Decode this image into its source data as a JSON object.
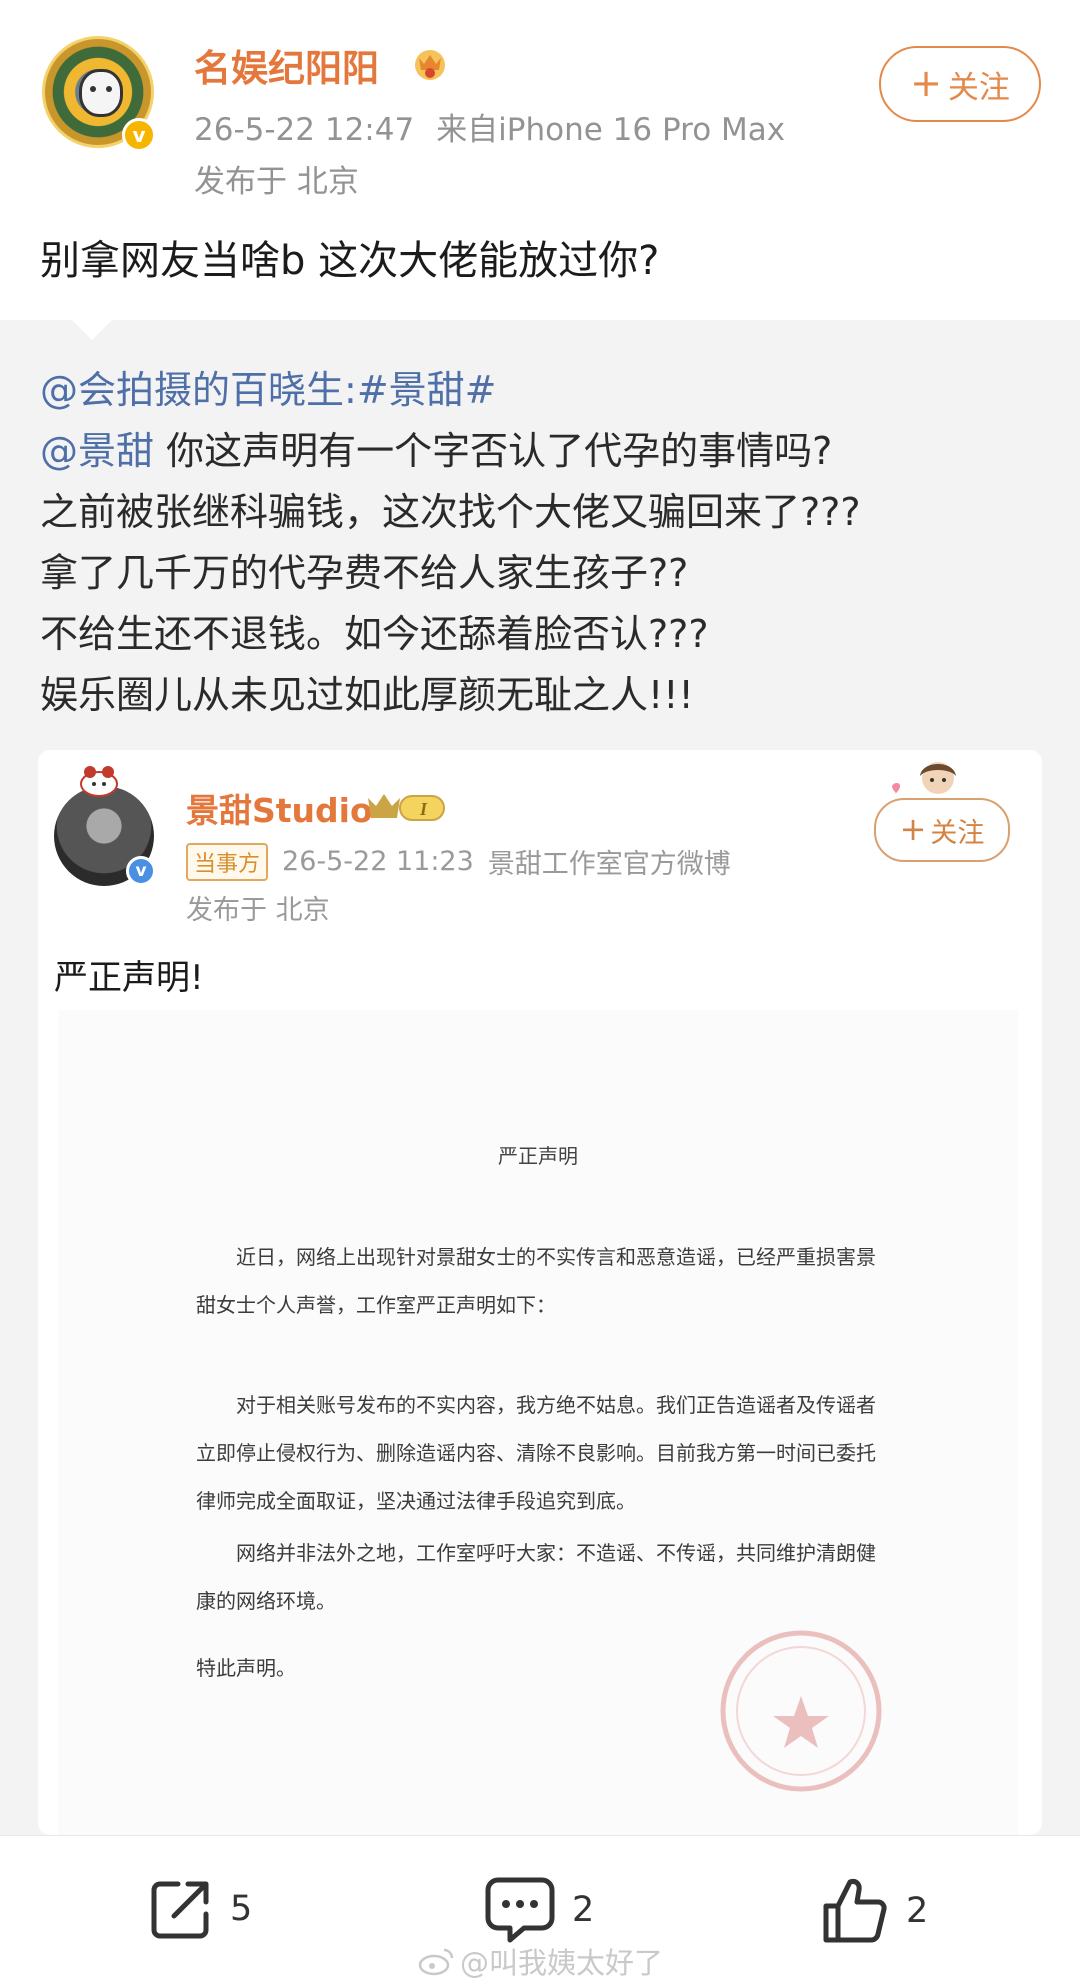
{
  "post": {
    "username": "名娱纪阳阳",
    "timestamp": "26-5-22 12:47",
    "source": "来自iPhone 16 Pro Max",
    "location": "发布于 北京",
    "follow_label": "关注",
    "follow_plus": "+",
    "text": "别拿网友当啥b 这次大佬能放过你?",
    "avatar_icon": "husky-sunflower-avatar",
    "badge_icon": "crown-icon",
    "accent_color": "#e4773b"
  },
  "repost": {
    "mention": "@会拍摄的百晓生:",
    "hashtag": "#景甜#",
    "line2_mention": "@景甜",
    "line2_rest": " 你这声明有一个字否认了代孕的事情吗?",
    "line3": "之前被张继科骗钱，这次找个大佬又骗回来了???",
    "line4": "拿了几千万的代孕费不给人家生孩子??",
    "line5": "不给生还不退钱。如今还舔着脸否认???",
    "line6": "娱乐圈儿从未见过如此厚颜无耻之人!!!"
  },
  "quoted": {
    "username": "景甜Studio",
    "party_tag": "当事方",
    "timestamp": "26-5-22 11:23",
    "source": "景甜工作室官方微博",
    "location": "发布于 北京",
    "follow_label": "关注",
    "follow_plus": "+",
    "title": "严正声明!",
    "doc": {
      "title": "严正声明",
      "p1": "近日，网络上出现针对景甜女士的不实传言和恶意造谣，已经严重损害景甜女士个人声誉，工作室严正声明如下：",
      "p2": "对于相关账号发布的不实内容，我方绝不姑息。我们正告造谣者及传谣者立即停止侵权行为、删除造谣内容、清除不良影响。目前我方第一时间已委托律师完成全面取证，坚决通过法律手段追究到底。",
      "p3": "网络并非法外之地，工作室呼吁大家：不造谣、不传谣，共同维护清朗健康的网络环境。",
      "closing": "特此声明。"
    }
  },
  "actions": {
    "share_count": "5",
    "comment_count": "2",
    "like_count": "2"
  },
  "watermark": "@叫我姨太好了"
}
